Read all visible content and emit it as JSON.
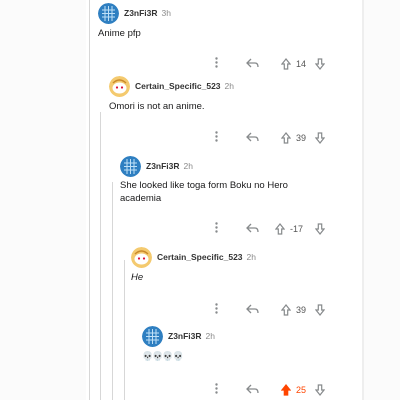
{
  "comments": [
    {
      "user": "Z3nFi3R",
      "time": "3h",
      "body": "Anime pfp",
      "score": "14",
      "avatar": "blue-cube-avatar"
    },
    {
      "user": "Certain_Specific_523",
      "time": "2h",
      "body": "Omori is not an anime.",
      "score": "39",
      "avatar": "snoo-avatar"
    },
    {
      "user": "Z3nFi3R",
      "time": "2h",
      "body": "She looked like toga  form Boku no Hero academia",
      "score": "-17",
      "avatar": "blue-cube-avatar"
    },
    {
      "user": "Certain_Specific_523",
      "time": "2h",
      "body": "He",
      "score": "39",
      "avatar": "snoo-avatar"
    },
    {
      "user": "Z3nFi3R",
      "time": "2h",
      "body": "💀💀💀💀",
      "score": "25",
      "avatar": "blue-cube-avatar",
      "upvoted": true
    }
  ],
  "icons": {
    "more": "more-dots-icon",
    "reply": "reply-icon",
    "upvote": "upvote-icon",
    "downvote": "downvote-icon"
  },
  "colors": {
    "upvote_active": "#ff4500",
    "avatar_blue": "#2f7fc1",
    "snoo_bg": "#f4ca6f"
  }
}
